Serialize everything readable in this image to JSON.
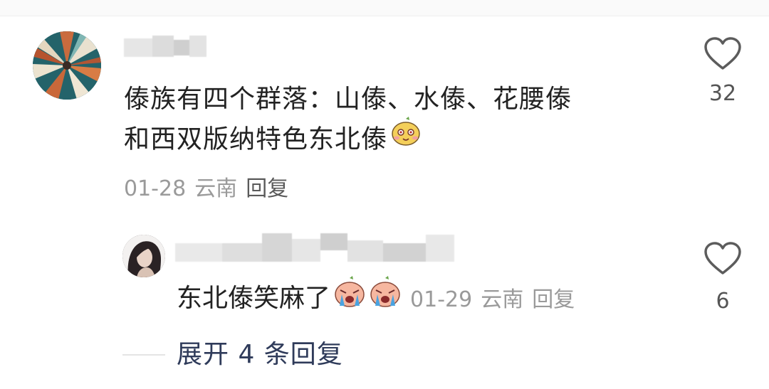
{
  "comment": {
    "username": "",
    "text_line_1": "傣族有四个群落：山傣、水傣、花腰傣",
    "text_line_2": "和西双版纳特色东北傣",
    "emoji": "smiling-fruit-emoji",
    "date": "01-28",
    "location": "云南",
    "reply_label": "回复",
    "likes": "32"
  },
  "reply": {
    "username": "",
    "text": "东北傣笑麻了",
    "emojis": [
      "crying-fruit-emoji",
      "crying-fruit-emoji"
    ],
    "date": "01-29",
    "location": "云南",
    "reply_label": "回复",
    "likes": "6"
  },
  "expand": {
    "label": "展开 4 条回复"
  },
  "colors": {
    "text": "#222222",
    "meta": "#9a9a9a",
    "expand": "#2f3b5a"
  }
}
